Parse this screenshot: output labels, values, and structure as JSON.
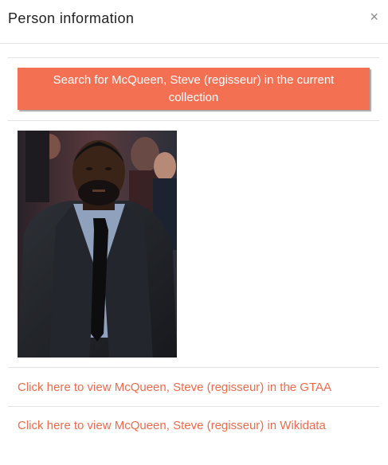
{
  "dialog": {
    "title": "Person information",
    "close_glyph": "×"
  },
  "search_button": {
    "label": "Search for McQueen, Steve (regisseur) in the current collection"
  },
  "photo": {
    "subject": "McQueen, Steve (regisseur)"
  },
  "links": {
    "gtaa": "Click here to view McQueen, Steve (regisseur) in the GTAA",
    "wikidata": "Click here to view McQueen, Steve (regisseur) in Wikidata"
  },
  "colors": {
    "accent": "#f37052",
    "link": "#ef6b4b"
  },
  "icons": {
    "close": "close-icon"
  }
}
